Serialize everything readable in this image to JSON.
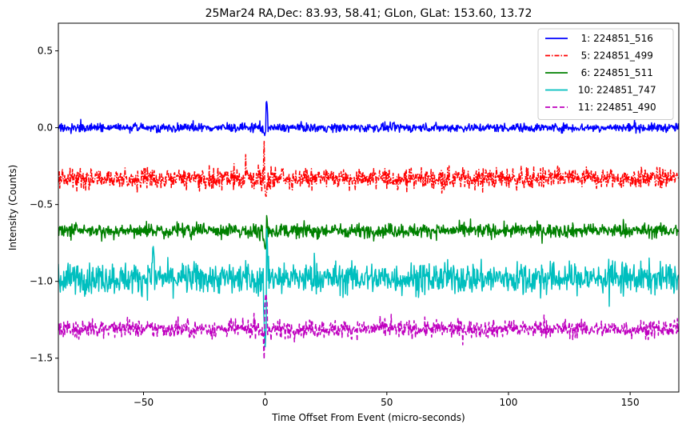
{
  "chart_data": {
    "type": "line",
    "title": "25Mar24 RA,Dec:   83.93,  58.41; GLon, GLat:  153.60,  13.72",
    "xlabel": "Time Offset From Event (micro-seconds)",
    "ylabel": "Intensity (Counts)",
    "xlim": [
      -85,
      170
    ],
    "ylim": [
      -1.72,
      0.68
    ],
    "xticks": [
      -50,
      0,
      50,
      100,
      150
    ],
    "xtick_labels": [
      "−50",
      "0",
      "50",
      "100",
      "150"
    ],
    "yticks": [
      0.5,
      0.0,
      -0.5,
      -1.0,
      -1.5
    ],
    "ytick_labels": [
      "0.5",
      "0.0",
      "−0.5",
      "−1.0",
      "−1.5"
    ],
    "grid": false,
    "legend_position": "top-right",
    "series": [
      {
        "name": "  1: 224851_516",
        "color": "#0000ff",
        "dash": "solid",
        "baseline": 0.0,
        "noise_amplitude": 0.025,
        "peaks": [
          {
            "x": 0.5,
            "y": 0.18
          },
          {
            "x": -0.3,
            "y": -0.05
          }
        ],
        "range": [
          -0.05,
          0.18
        ]
      },
      {
        "name": "  5: 224851_499",
        "color": "#ff0000",
        "dash": "dashdot",
        "baseline": -0.33,
        "noise_amplitude": 0.06,
        "peaks": [
          {
            "x": 0.0,
            "y": 0.05
          },
          {
            "x": 0.3,
            "y": -0.45
          }
        ],
        "range": [
          -0.46,
          0.05
        ]
      },
      {
        "name": "  6: 224851_511",
        "color": "#008000",
        "dash": "solid",
        "baseline": -0.67,
        "noise_amplitude": 0.04,
        "peaks": [
          {
            "x": 0.3,
            "y": -0.5
          },
          {
            "x": 0.0,
            "y": -0.8
          }
        ],
        "range": [
          -0.8,
          -0.5
        ]
      },
      {
        "name": " 10: 224851_747",
        "color": "#00bfbf",
        "dash": "solid",
        "baseline": -0.98,
        "noise_amplitude": 0.09,
        "peaks": [
          {
            "x": 0.5,
            "y": -0.65
          },
          {
            "x": 0.0,
            "y": -1.45
          },
          {
            "x": -46,
            "y": -0.78
          }
        ],
        "range": [
          -1.45,
          -0.65
        ]
      },
      {
        "name": " 11: 224851_490",
        "color": "#bf00bf",
        "dash": "dashed",
        "baseline": -1.31,
        "noise_amplitude": 0.05,
        "peaks": [
          {
            "x": 0.0,
            "y": -1.64
          },
          {
            "x": 0.3,
            "y": -1.05
          }
        ],
        "range": [
          -1.64,
          -1.05
        ]
      }
    ]
  }
}
